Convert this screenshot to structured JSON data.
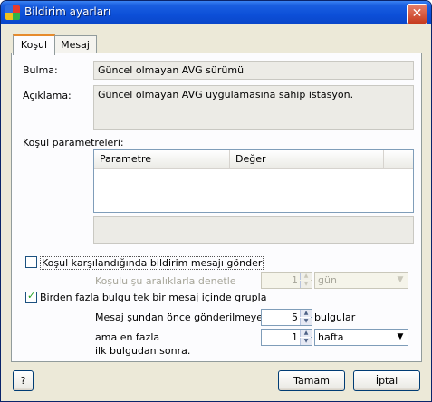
{
  "window": {
    "title": "Bildirim ayarları",
    "close_glyph": "✕"
  },
  "tabs": [
    {
      "label": "Koşul",
      "active": true
    },
    {
      "label": "Mesaj",
      "active": false
    }
  ],
  "form": {
    "bulma_label": "Bulma:",
    "bulma_value": "Güncel olmayan AVG sürümü",
    "aciklama_label": "Açıklama:",
    "aciklama_value": "Güncel olmayan AVG uygulamasına sahip istasyon.",
    "params_label": "Koşul parametreleri:",
    "params_columns": [
      "Parametre",
      "Değer"
    ]
  },
  "options": {
    "notify_checkbox": {
      "label": "Koşul karşılandığında bildirim mesajı gönder",
      "checked": false
    },
    "interval_label": "Koşulu şu aralıklarla denetle",
    "interval_value": "1",
    "interval_unit": "gün",
    "group_checkbox": {
      "label": "Birden fazla bulgu tek bir mesaj içinde grupla",
      "checked": true
    },
    "wait_label": "Mesaj şundan önce gönderilmeyecek",
    "wait_value": "5",
    "wait_unit": "bulgular",
    "max_label": "ama en fazla",
    "max_value": "1",
    "max_unit": "hafta",
    "after_label": "ilk bulgudan sonra."
  },
  "buttons": {
    "help": "?",
    "ok": "Tamam",
    "cancel": "İptal"
  },
  "colors": {
    "title_bar": "#0c4fd8",
    "tab_accent": "#e68b2c",
    "panel_bg": "#fcfcfe",
    "window_bg": "#ece9d8"
  }
}
